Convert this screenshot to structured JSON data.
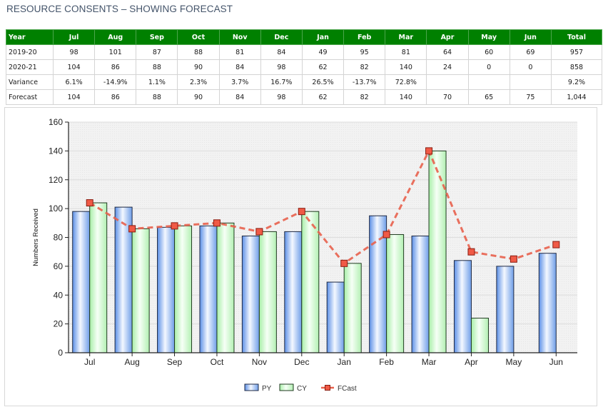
{
  "page": {
    "title": "RESOURCE CONSENTS – SHOWING FORECAST"
  },
  "table": {
    "headers": [
      "Year",
      "Jul",
      "Aug",
      "Sep",
      "Oct",
      "Nov",
      "Dec",
      "Jan",
      "Feb",
      "Mar",
      "Apr",
      "May",
      "Jun",
      "Total"
    ],
    "rows": [
      [
        "2019-20",
        "98",
        "101",
        "87",
        "88",
        "81",
        "84",
        "49",
        "95",
        "81",
        "64",
        "60",
        "69",
        "957"
      ],
      [
        "2020-21",
        "104",
        "86",
        "88",
        "90",
        "84",
        "98",
        "62",
        "82",
        "140",
        "24",
        "0",
        "0",
        "858"
      ],
      [
        "Variance",
        "6.1%",
        "-14.9%",
        "1.1%",
        "2.3%",
        "3.7%",
        "16.7%",
        "26.5%",
        "-13.7%",
        "72.8%",
        "",
        "",
        "",
        "9.2%"
      ],
      [
        "Forecast",
        "104",
        "86",
        "88",
        "90",
        "84",
        "98",
        "62",
        "82",
        "140",
        "70",
        "65",
        "75",
        "1,044"
      ]
    ]
  },
  "colors": {
    "header_green": "#008000",
    "py_blue": "#6f9ee8",
    "cy_green": "#b7f0b7",
    "fcast_red": "#e8604c",
    "title_color": "#44546a"
  },
  "chart_data": {
    "type": "bar",
    "title": "",
    "xlabel": "",
    "ylabel": "Numbers Received",
    "ylim": [
      0,
      160
    ],
    "yticks": [
      0,
      20,
      40,
      60,
      80,
      100,
      120,
      140,
      160
    ],
    "grid": true,
    "legend_position": "bottom-center",
    "categories": [
      "Jul",
      "Aug",
      "Sep",
      "Oct",
      "Nov",
      "Dec",
      "Jan",
      "Feb",
      "Mar",
      "Apr",
      "May",
      "Jun"
    ],
    "series": [
      {
        "name": "PY",
        "kind": "bar",
        "values": [
          98,
          101,
          87,
          88,
          81,
          84,
          49,
          95,
          81,
          64,
          60,
          69
        ]
      },
      {
        "name": "CY",
        "kind": "bar",
        "values": [
          104,
          86,
          88,
          90,
          84,
          98,
          62,
          82,
          140,
          24,
          0,
          0
        ]
      },
      {
        "name": "FCast",
        "kind": "line",
        "style": "dashed",
        "marker": "square",
        "values": [
          104,
          86,
          88,
          90,
          84,
          98,
          62,
          82,
          140,
          70,
          65,
          75
        ]
      }
    ]
  }
}
